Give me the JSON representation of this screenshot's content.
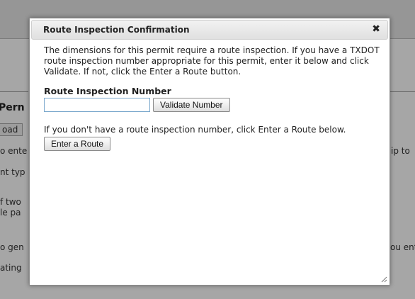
{
  "background": {
    "heading": "Pern",
    "tab": "oad",
    "fragments": [
      "o ente",
      "nt typ",
      "f two",
      "le pa",
      "o gen",
      "ating"
    ],
    "right_fragments": [
      "ip to",
      "ou ent"
    ]
  },
  "dialog": {
    "title": "Route Inspection Confirmation",
    "close_glyph": "✖",
    "intro": "The dimensions for this permit require a route inspection. If you have a TXDOT route inspection number appropriate for this permit, enter it below and click Validate. If not, click the Enter a Route button.",
    "field_label": "Route Inspection Number",
    "input_value": "",
    "validate_label": "Validate Number",
    "no_number_text": "If you don't have a route inspection number, click Enter a Route below.",
    "enter_route_label": "Enter a Route"
  }
}
